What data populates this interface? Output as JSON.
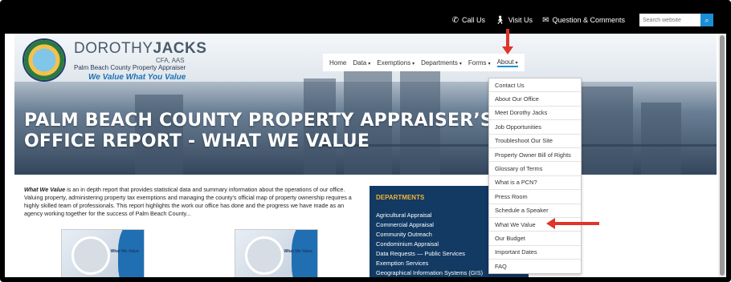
{
  "topbar": {
    "call_us": "Call Us",
    "visit_us": "Visit Us",
    "questions": "Question & Comments",
    "search_placeholder": "Search website"
  },
  "brand": {
    "name_light": "DOROTHY",
    "name_bold": "JACKS",
    "credentials": "CFA, AAS",
    "subtitle": "Palm Beach County Property Appraiser",
    "tagline": "We Value What You Value"
  },
  "nav": {
    "items": [
      {
        "label": "Home",
        "caret": false
      },
      {
        "label": "Data",
        "caret": true
      },
      {
        "label": "Exemptions",
        "caret": true
      },
      {
        "label": "Departments",
        "caret": true
      },
      {
        "label": "Forms",
        "caret": true
      },
      {
        "label": "About",
        "caret": true
      }
    ]
  },
  "hero": {
    "title_line1": "PALM BEACH COUNTY PROPERTY APPRAISER’S",
    "title_line2": "OFFICE REPORT - WHAT WE VALUE"
  },
  "intro": {
    "lead": "What We Value",
    "body": " is an in depth report that provides statistical data and summary information about the operations of our office. Valuing property, administering property tax exemptions and managing the county’s official map of property ownership requires a highly skilled team of professionals. This report highlights the work our office has done and the progress we have made as an agency working together for the success of Palm Beach County..."
  },
  "report_card_label": "What We Value",
  "departments": {
    "title": "DEPARTMENTS",
    "items": [
      "Agricultural Appraisal",
      "Commercial Appraisal",
      "Community Outreach",
      "Condominium Appraisal",
      "Data Requests — Public Services",
      "Exemption Services",
      "Geographical Information Systems (GIS)"
    ]
  },
  "about_menu": {
    "items": [
      "Contact Us",
      "About Our Office",
      "Meet Dorothy Jacks",
      "Job Opportunities",
      "Troubleshoot Our Site",
      "Property Owner Bill of Rights",
      "Glossary of Terms",
      "What is a PCN?",
      "Press Room",
      "Schedule a Speaker",
      "What We Value",
      "Our Budget",
      "Important Dates",
      "FAQ"
    ]
  },
  "colors": {
    "accent": "#1a8fd6",
    "department_bg": "#123a63",
    "department_title": "#f2b233",
    "annotation_arrow": "#e0342b"
  }
}
